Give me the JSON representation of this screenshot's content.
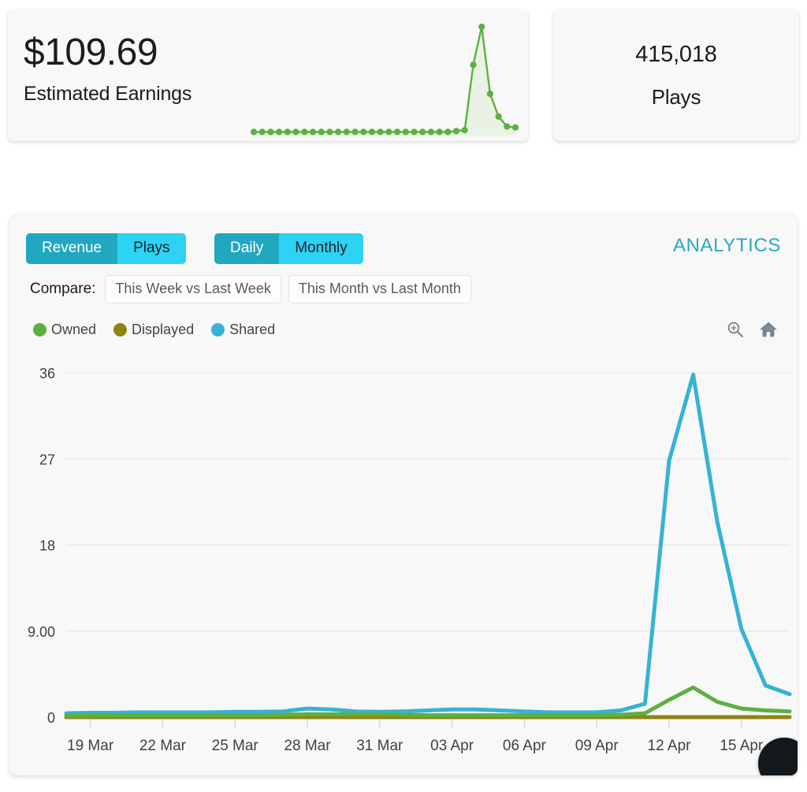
{
  "earnings_card": {
    "amount": "$109.69",
    "label": "Estimated Earnings",
    "sparkline": {
      "type": "area",
      "color": "#54a council",
      "values": [
        0.4,
        0.4,
        0.4,
        0.4,
        0.4,
        0.4,
        0.4,
        0.4,
        0.4,
        0.4,
        0.4,
        0.4,
        0.4,
        0.4,
        0.4,
        0.4,
        0.4,
        0.4,
        0.4,
        0.4,
        0.4,
        0.4,
        0.4,
        0.4,
        0.5,
        0.6,
        7.8,
        12.0,
        4.6,
        2.1,
        1.0,
        0.9
      ],
      "max": 12.0
    }
  },
  "plays_card": {
    "count": "415,018",
    "label": "Plays"
  },
  "analytics": {
    "title": "ANALYTICS",
    "metric_toggle": {
      "selected": "Revenue",
      "options": [
        "Revenue",
        "Plays"
      ]
    },
    "period_toggle": {
      "selected": "Daily",
      "options": [
        "Daily",
        "Monthly"
      ]
    },
    "compare": {
      "label": "Compare:",
      "options": [
        "This Week vs Last Week",
        "This Month vs Last Month"
      ]
    },
    "legend": [
      {
        "label": "Owned",
        "color": "#5cb040"
      },
      {
        "label": "Displayed",
        "color": "#8e8512"
      },
      {
        "label": "Shared",
        "color": "#36b3d2"
      }
    ],
    "tools": [
      {
        "name": "zoom-in-icon",
        "label": "Zoom in"
      },
      {
        "name": "home-icon",
        "label": "Reset zoom"
      }
    ]
  },
  "chart_data": {
    "type": "line",
    "title": "ANALYTICS",
    "xlabel": "",
    "ylabel": "",
    "grid": true,
    "legend_position": "top-left",
    "ylim": [
      0,
      36
    ],
    "y_ticks": [
      "0",
      "9.00",
      "18",
      "27",
      "36"
    ],
    "y_tick_values": [
      0,
      9,
      18,
      27,
      36
    ],
    "x_tick_labels": [
      "19 Mar",
      "22 Mar",
      "25 Mar",
      "28 Mar",
      "31 Mar",
      "03 Apr",
      "06 Apr",
      "09 Apr",
      "12 Apr",
      "15 Apr"
    ],
    "x": [
      "18 Mar",
      "19 Mar",
      "20 Mar",
      "21 Mar",
      "22 Mar",
      "23 Mar",
      "24 Mar",
      "25 Mar",
      "26 Mar",
      "27 Mar",
      "28 Mar",
      "29 Mar",
      "30 Mar",
      "31 Mar",
      "01 Apr",
      "02 Apr",
      "03 Apr",
      "04 Apr",
      "05 Apr",
      "06 Apr",
      "07 Apr",
      "08 Apr",
      "09 Apr",
      "10 Apr",
      "11 Apr",
      "12 Apr",
      "13 Apr",
      "14 Apr",
      "15 Apr",
      "16 Apr",
      "17 Apr"
    ],
    "series": [
      {
        "name": "Owned",
        "color": "#5cb040",
        "values": [
          0.15,
          0.15,
          0.2,
          0.2,
          0.2,
          0.2,
          0.2,
          0.2,
          0.2,
          0.25,
          0.3,
          0.3,
          0.3,
          0.3,
          0.25,
          0.2,
          0.2,
          0.2,
          0.2,
          0.2,
          0.2,
          0.2,
          0.2,
          0.25,
          0.4,
          1.8,
          3.1,
          1.6,
          0.9,
          0.7,
          0.6
        ]
      },
      {
        "name": "Displayed",
        "color": "#8e8512",
        "values": [
          0,
          0,
          0,
          0,
          0,
          0,
          0,
          0,
          0,
          0,
          0,
          0,
          0,
          0,
          0,
          0,
          0,
          0,
          0,
          0,
          0,
          0,
          0,
          0,
          0,
          0,
          0,
          0,
          0,
          0,
          0
        ]
      },
      {
        "name": "Shared",
        "color": "#36b3d2",
        "values": [
          0.4,
          0.45,
          0.45,
          0.5,
          0.5,
          0.5,
          0.5,
          0.55,
          0.55,
          0.6,
          0.9,
          0.8,
          0.6,
          0.55,
          0.6,
          0.7,
          0.8,
          0.8,
          0.7,
          0.6,
          0.5,
          0.5,
          0.5,
          0.7,
          1.4,
          26.8,
          35.8,
          20.4,
          9.2,
          3.3,
          2.4
        ]
      }
    ]
  }
}
